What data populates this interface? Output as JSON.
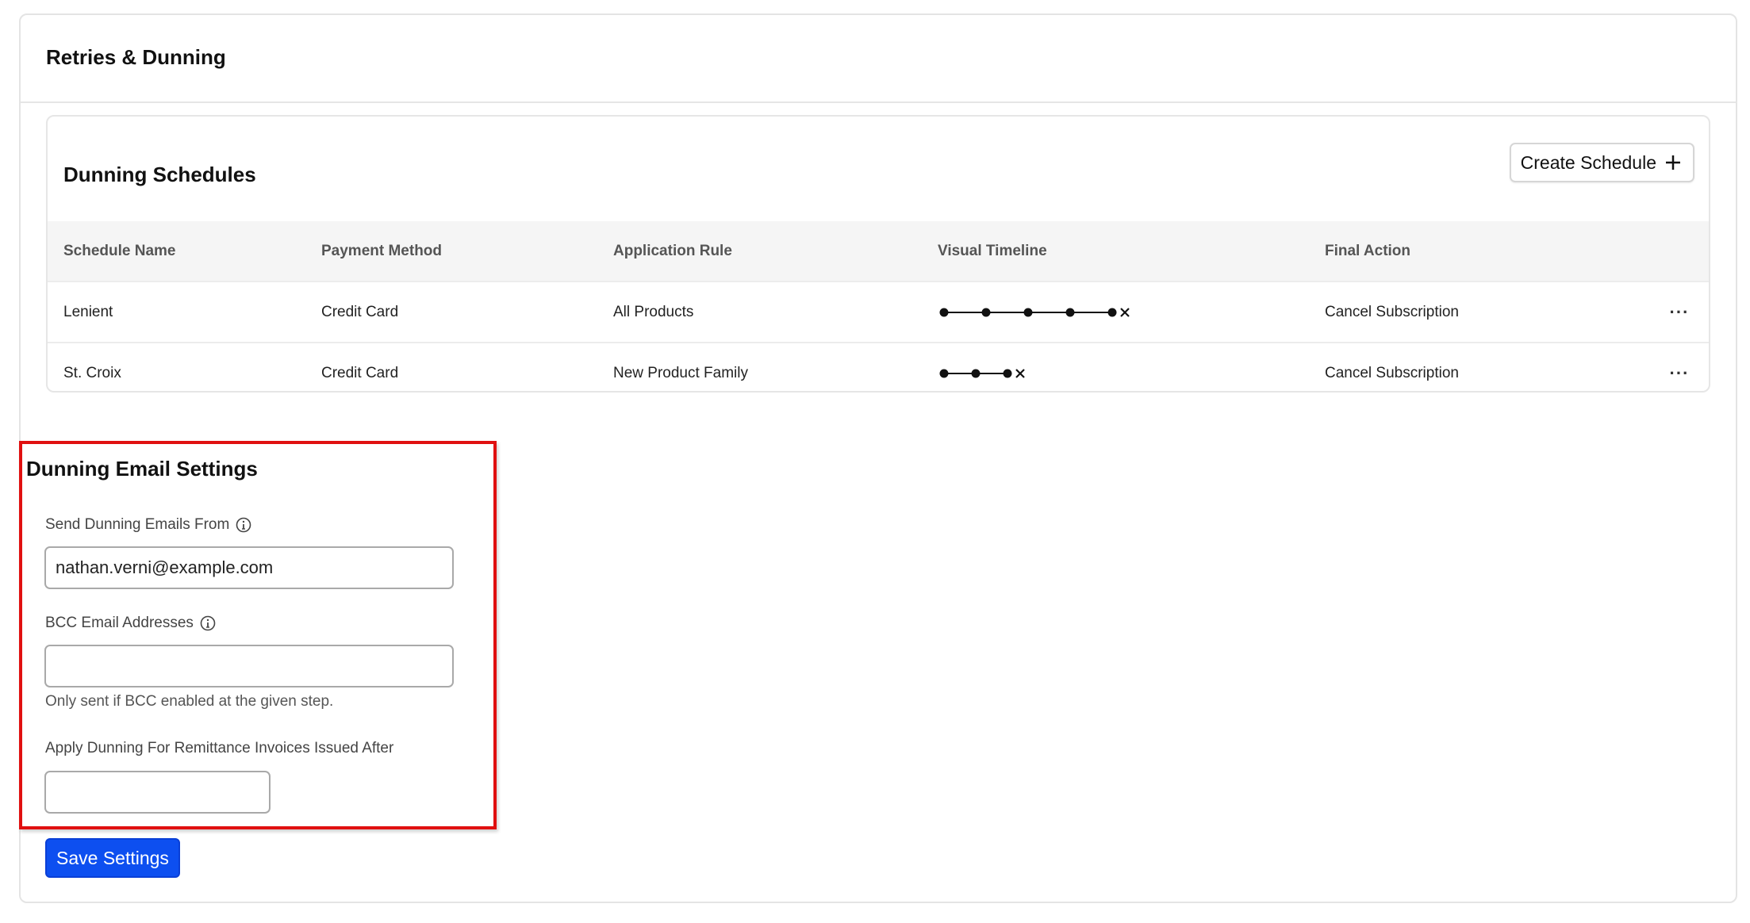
{
  "page": {
    "title": "Retries & Dunning"
  },
  "schedules": {
    "title": "Dunning Schedules",
    "create_label": "Create Schedule",
    "columns": [
      "Schedule Name",
      "Payment Method",
      "Application Rule",
      "Visual Timeline",
      "Final Action"
    ],
    "rows": [
      {
        "name": "Lenient",
        "payment_method": "Credit Card",
        "application_rule": "All Products",
        "timeline_steps": 5,
        "final_action": "Cancel Subscription"
      },
      {
        "name": "St. Croix",
        "payment_method": "Credit Card",
        "application_rule": "New Product Family",
        "timeline_steps": 3,
        "final_action": "Cancel Subscription"
      }
    ]
  },
  "email_settings": {
    "title": "Dunning Email Settings",
    "from_label": "Send Dunning Emails From",
    "from_value": "nathan.verni@example.com",
    "bcc_label": "BCC Email Addresses",
    "bcc_value": "",
    "bcc_helper": "Only sent if BCC enabled at the given step.",
    "remittance_label": "Apply Dunning For Remittance Invoices Issued After",
    "remittance_value": ""
  },
  "actions": {
    "save_label": "Save Settings"
  },
  "colors": {
    "primary": "#0d4ff0",
    "highlight": "#e01010"
  }
}
